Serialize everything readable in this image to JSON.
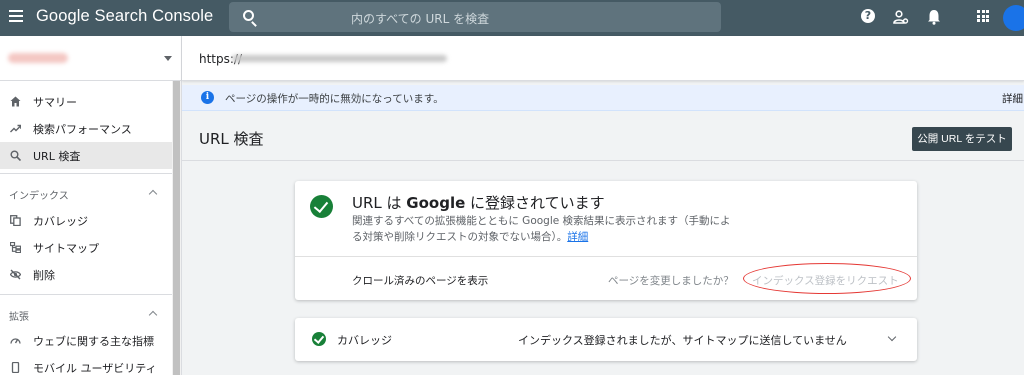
{
  "app": {
    "title_brand": "Google",
    "title_product": "Search Console"
  },
  "search": {
    "placeholder": "内のすべての URL を検査"
  },
  "topbar": {
    "help_symbol": "?"
  },
  "sidebar": {
    "items_top": [
      {
        "label": "サマリー",
        "icon": "home-icon"
      },
      {
        "label": "検索パフォーマンス",
        "icon": "trending-up-icon"
      },
      {
        "label": "URL 検査",
        "icon": "search-icon",
        "active": true
      }
    ],
    "index_section": {
      "title": "インデックス",
      "items": [
        {
          "label": "カバレッジ",
          "icon": "file-copy-icon"
        },
        {
          "label": "サイトマップ",
          "icon": "sitemap-icon"
        },
        {
          "label": "削除",
          "icon": "visibility-off-icon"
        }
      ]
    },
    "ext_section": {
      "title": "拡張",
      "items": [
        {
          "label": "ウェブに関する主な指標",
          "icon": "speed-icon"
        },
        {
          "label": "モバイル ユーザビリティ",
          "icon": "smartphone-icon"
        }
      ]
    }
  },
  "urlbar": {
    "prefix": "https://"
  },
  "banner": {
    "text": "ページの操作が一時的に無効になっています。",
    "link": "詳細"
  },
  "page": {
    "title": "URL 検査",
    "test_button": "公開 URL をテスト"
  },
  "result": {
    "title_prefix": "URL は ",
    "title_brand": "Google",
    "title_suffix": " に登録されています",
    "desc_line1": "関連するすべての拡張機能とともに Google 検索結果に表示されます（手動によ",
    "desc_line2": "る対策や削除リクエストの対象でない場合）。",
    "desc_link": "詳細",
    "crawled_link": "クロール済みのページを表示",
    "changed_question": "ページを変更しましたか？",
    "request_index": "インデックス登録をリクエスト"
  },
  "coverage": {
    "label": "カバレッジ",
    "status": "インデックス登録されましたが、サイトマップに送信していません"
  },
  "colors": {
    "topbar": "#455a64",
    "success_green": "#188038",
    "info_blue": "#1a73e8",
    "annotation_red": "#e53935"
  }
}
